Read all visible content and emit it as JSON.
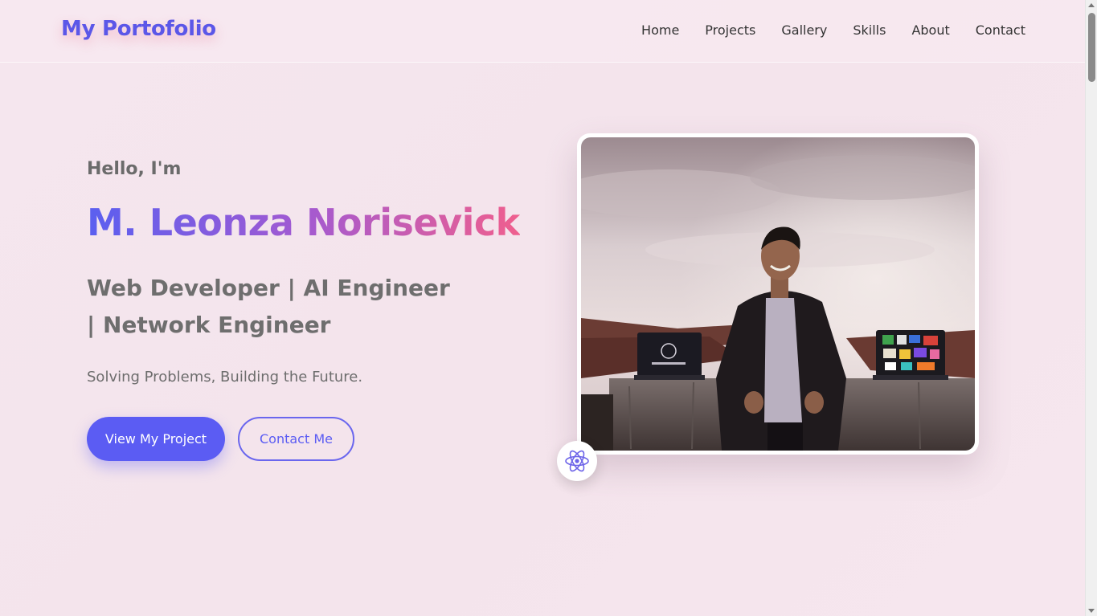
{
  "nav": {
    "logo": "My Portofolio",
    "links": [
      "Home",
      "Projects",
      "Gallery",
      "Skills",
      "About",
      "Contact"
    ]
  },
  "hero": {
    "greeting": "Hello, I'm",
    "name": "M. Leonza Norisevick",
    "roles": "Web Developer | AI Engineer | Network Engineer",
    "tagline": "Solving Problems, Building the Future.",
    "primary_button": "View My Project",
    "secondary_button": "Contact Me",
    "badge_icon": "react-atom-icon"
  },
  "colors": {
    "accent": "#5b5cf3",
    "gradient_start": "#5a5ff0",
    "gradient_end": "#ef5f8e"
  }
}
